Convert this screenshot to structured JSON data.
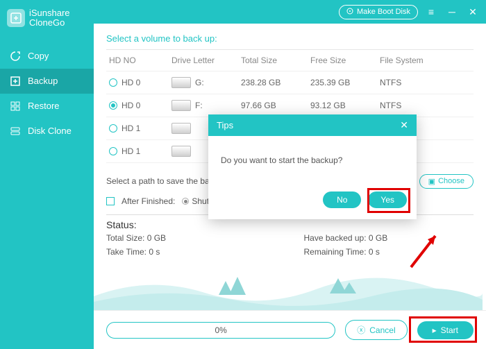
{
  "brand": {
    "line1": "iSunshare",
    "line2": "CloneGo"
  },
  "titlebar": {
    "make_boot": "Make Boot Disk"
  },
  "nav": {
    "items": [
      {
        "label": "Copy"
      },
      {
        "label": "Backup"
      },
      {
        "label": "Restore"
      },
      {
        "label": "Disk Clone"
      }
    ]
  },
  "section": {
    "select_volume": "Select a volume to back up:",
    "headers": {
      "hd": "HD NO",
      "letter": "Drive Letter",
      "total": "Total Size",
      "free": "Free Size",
      "fs": "File System"
    },
    "rows": [
      {
        "hd": "HD 0",
        "letter": "G:",
        "total": "238.28 GB",
        "free": "235.39 GB",
        "fs": "NTFS",
        "selected": false
      },
      {
        "hd": "HD 0",
        "letter": "F:",
        "total": "97.66 GB",
        "free": "93.12 GB",
        "fs": "NTFS",
        "selected": true
      },
      {
        "hd": "HD 1",
        "letter": "",
        "total": "",
        "free": "",
        "fs": "",
        "selected": false
      },
      {
        "hd": "HD 1",
        "letter": "",
        "total": "",
        "free": "",
        "fs": "",
        "selected": false
      }
    ],
    "path_label": "Select a path to save the backup",
    "choose": "Choose",
    "after_label": "After Finished:",
    "after_opts": {
      "shutdown": "Shutdown"
    },
    "status": {
      "head": "Status:",
      "total": "Total Size: 0 GB",
      "backed": "Have backed up: 0 GB",
      "take": "Take Time: 0 s",
      "remain": "Remaining Time: 0 s"
    }
  },
  "footer": {
    "progress": "0%",
    "cancel": "Cancel",
    "start": "Start"
  },
  "dialog": {
    "title": "Tips",
    "message": "Do you want to start the backup?",
    "no": "No",
    "yes": "Yes"
  }
}
